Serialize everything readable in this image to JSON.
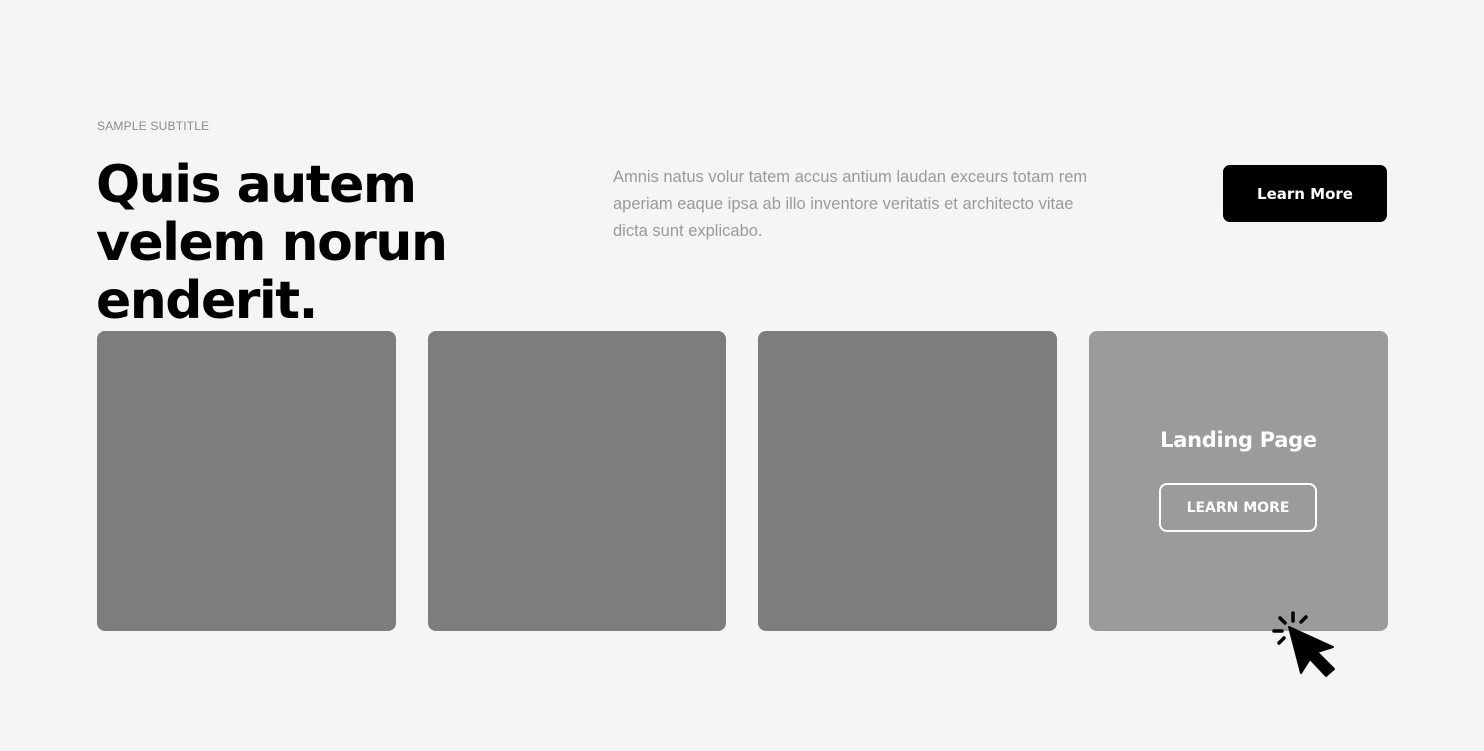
{
  "hero": {
    "subtitle": "SAMPLE SUBTITLE",
    "title": "Quis autem velem norun enderit.",
    "description": "Amnis natus volur tatem accus antium laudan exceurs totam rem aperiam eaque ipsa ab illo inventore veritatis et architecto vitae dicta sunt explicabo.",
    "cta_label": "Learn More"
  },
  "cards": [
    {
      "title": "",
      "button_label": ""
    },
    {
      "title": "",
      "button_label": ""
    },
    {
      "title": "",
      "button_label": ""
    },
    {
      "title": "Landing Page",
      "button_label": "LEARN MORE"
    }
  ],
  "colors": {
    "background": "#f5f5f5",
    "card": "#7c7d7e",
    "card_hover": "#9b9b9c",
    "cta": "#000000",
    "muted_text": "#9a9a9a"
  },
  "icons": {
    "cursor": "click-cursor-icon"
  }
}
